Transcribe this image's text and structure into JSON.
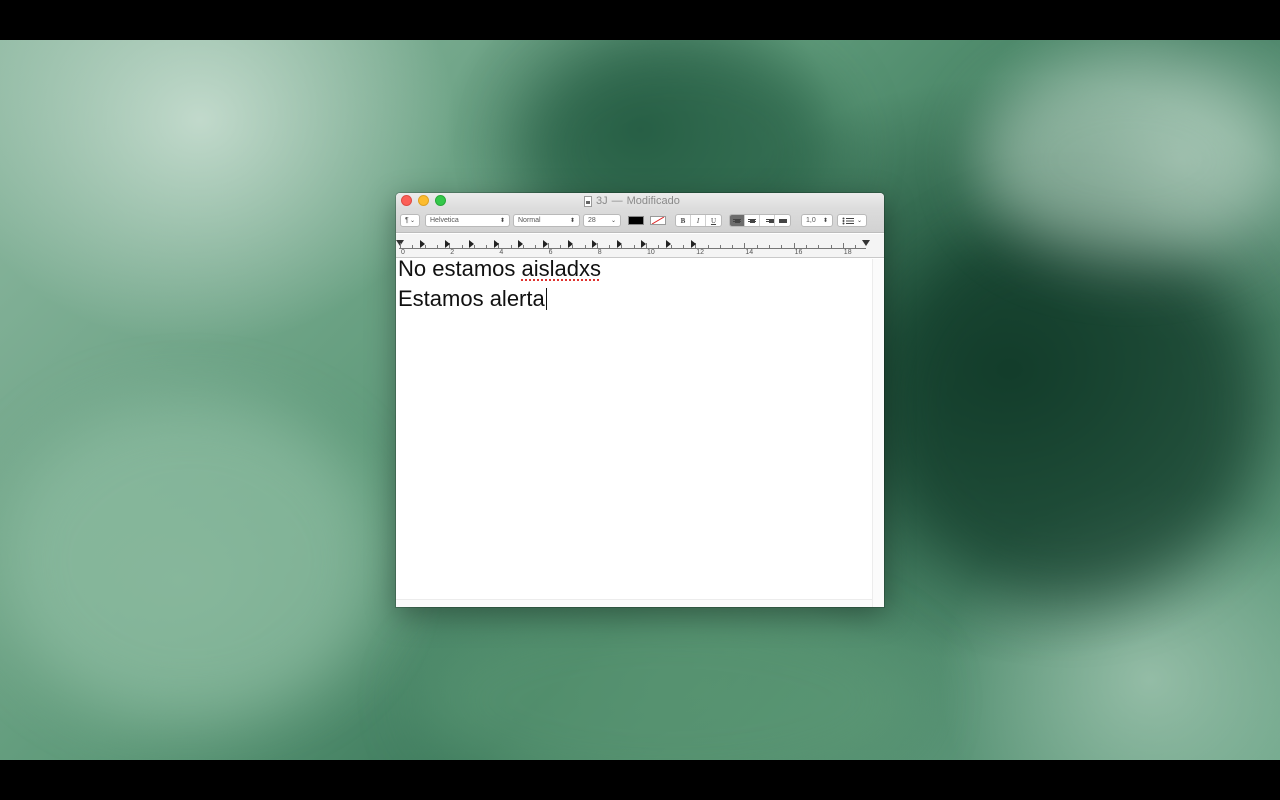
{
  "window": {
    "title": "3J",
    "separator": "—",
    "status": "Modificado"
  },
  "toolbar": {
    "paragraph_style": "¶",
    "font_family": "Helvetica",
    "font_style": "Normal",
    "font_size": "28",
    "text_color": "#000000",
    "bold_label": "B",
    "italic_label": "I",
    "underline_label": "U",
    "alignment_selected": "left",
    "line_spacing": "1,0",
    "list_icon": "list-bullets-icon"
  },
  "ruler": {
    "numbers": [
      "0",
      "2",
      "4",
      "6",
      "8",
      "10",
      "12",
      "14",
      "16",
      "18"
    ]
  },
  "document": {
    "line1_start": "No estamos ",
    "line1_misspelled": "aisladxs",
    "line2": "Estamos alerta"
  }
}
